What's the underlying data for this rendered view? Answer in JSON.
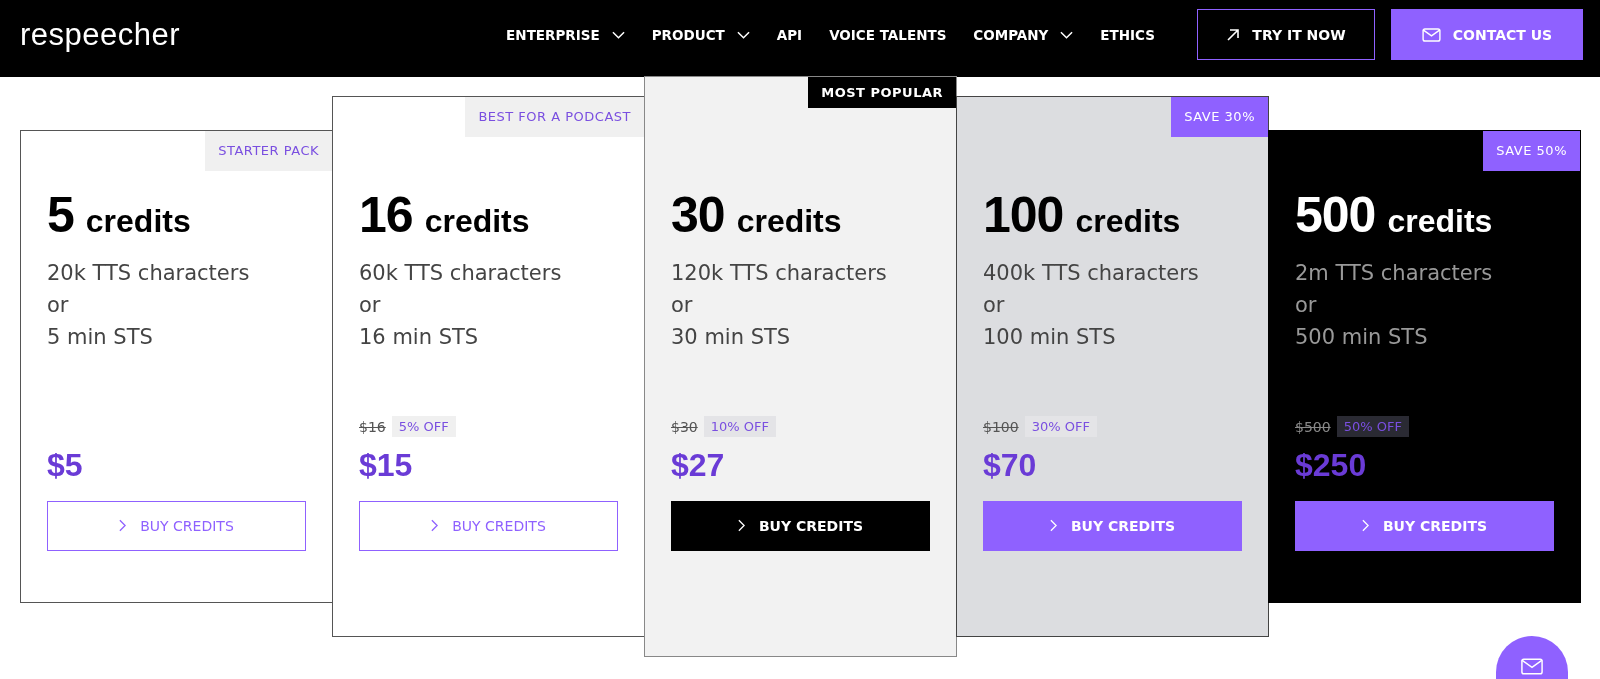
{
  "header": {
    "logo": "respeecher",
    "nav": [
      {
        "label": "ENTERPRISE",
        "dropdown": true
      },
      {
        "label": "PRODUCT",
        "dropdown": true
      },
      {
        "label": "API",
        "dropdown": false
      },
      {
        "label": "VOICE TALENTS",
        "dropdown": false
      },
      {
        "label": "COMPANY",
        "dropdown": true
      },
      {
        "label": "ETHICS",
        "dropdown": false
      }
    ],
    "buttons": [
      {
        "label": "TRY IT NOW",
        "kind": "outline"
      },
      {
        "label": "CONTACT US",
        "kind": "filled"
      }
    ]
  },
  "plans": [
    {
      "kind": "white",
      "tag": {
        "label": "STARTER PACK",
        "kind": "grey"
      },
      "amount": "5",
      "unit": "credits",
      "description": [
        "20k TTS characters",
        "or",
        "5 min STS"
      ],
      "price": "$5",
      "button": {
        "label": "BUY CREDITS",
        "kind": "outline"
      }
    },
    {
      "kind": "white",
      "tag": {
        "label": "BEST FOR A PODCAST",
        "kind": "grey"
      },
      "amount": "16",
      "unit": "credits",
      "description": [
        "60k TTS characters",
        "or",
        "16 min STS"
      ],
      "old_price": "$16",
      "discount": "5% OFF",
      "price": "$15",
      "button": {
        "label": "BUY CREDITS",
        "kind": "outline"
      }
    },
    {
      "kind": "light",
      "tag": {
        "label": "MOST POPULAR",
        "kind": "black"
      },
      "amount": "30",
      "unit": "credits",
      "description": [
        "120k TTS characters",
        "or",
        "30 min STS"
      ],
      "old_price": "$30",
      "discount": "10% OFF",
      "price": "$27",
      "button": {
        "label": "BUY CREDITS",
        "kind": "black"
      }
    },
    {
      "kind": "grey",
      "tag": {
        "label": "SAVE 30%",
        "kind": "purple"
      },
      "amount": "100",
      "unit": "credits",
      "description": [
        "400k TTS characters",
        "or",
        "100 min STS"
      ],
      "old_price": "$100",
      "discount": "30% OFF",
      "price": "$70",
      "button": {
        "label": "BUY CREDITS",
        "kind": "purple"
      }
    },
    {
      "kind": "dark",
      "tag": {
        "label": "SAVE 50%",
        "kind": "purple"
      },
      "amount": "500",
      "unit": "credits",
      "description": [
        "2m TTS characters",
        "or",
        "500 min STS"
      ],
      "old_price": "$500",
      "discount": "50% OFF",
      "price": "$250",
      "button": {
        "label": "BUY CREDITS",
        "kind": "purple"
      }
    }
  ]
}
